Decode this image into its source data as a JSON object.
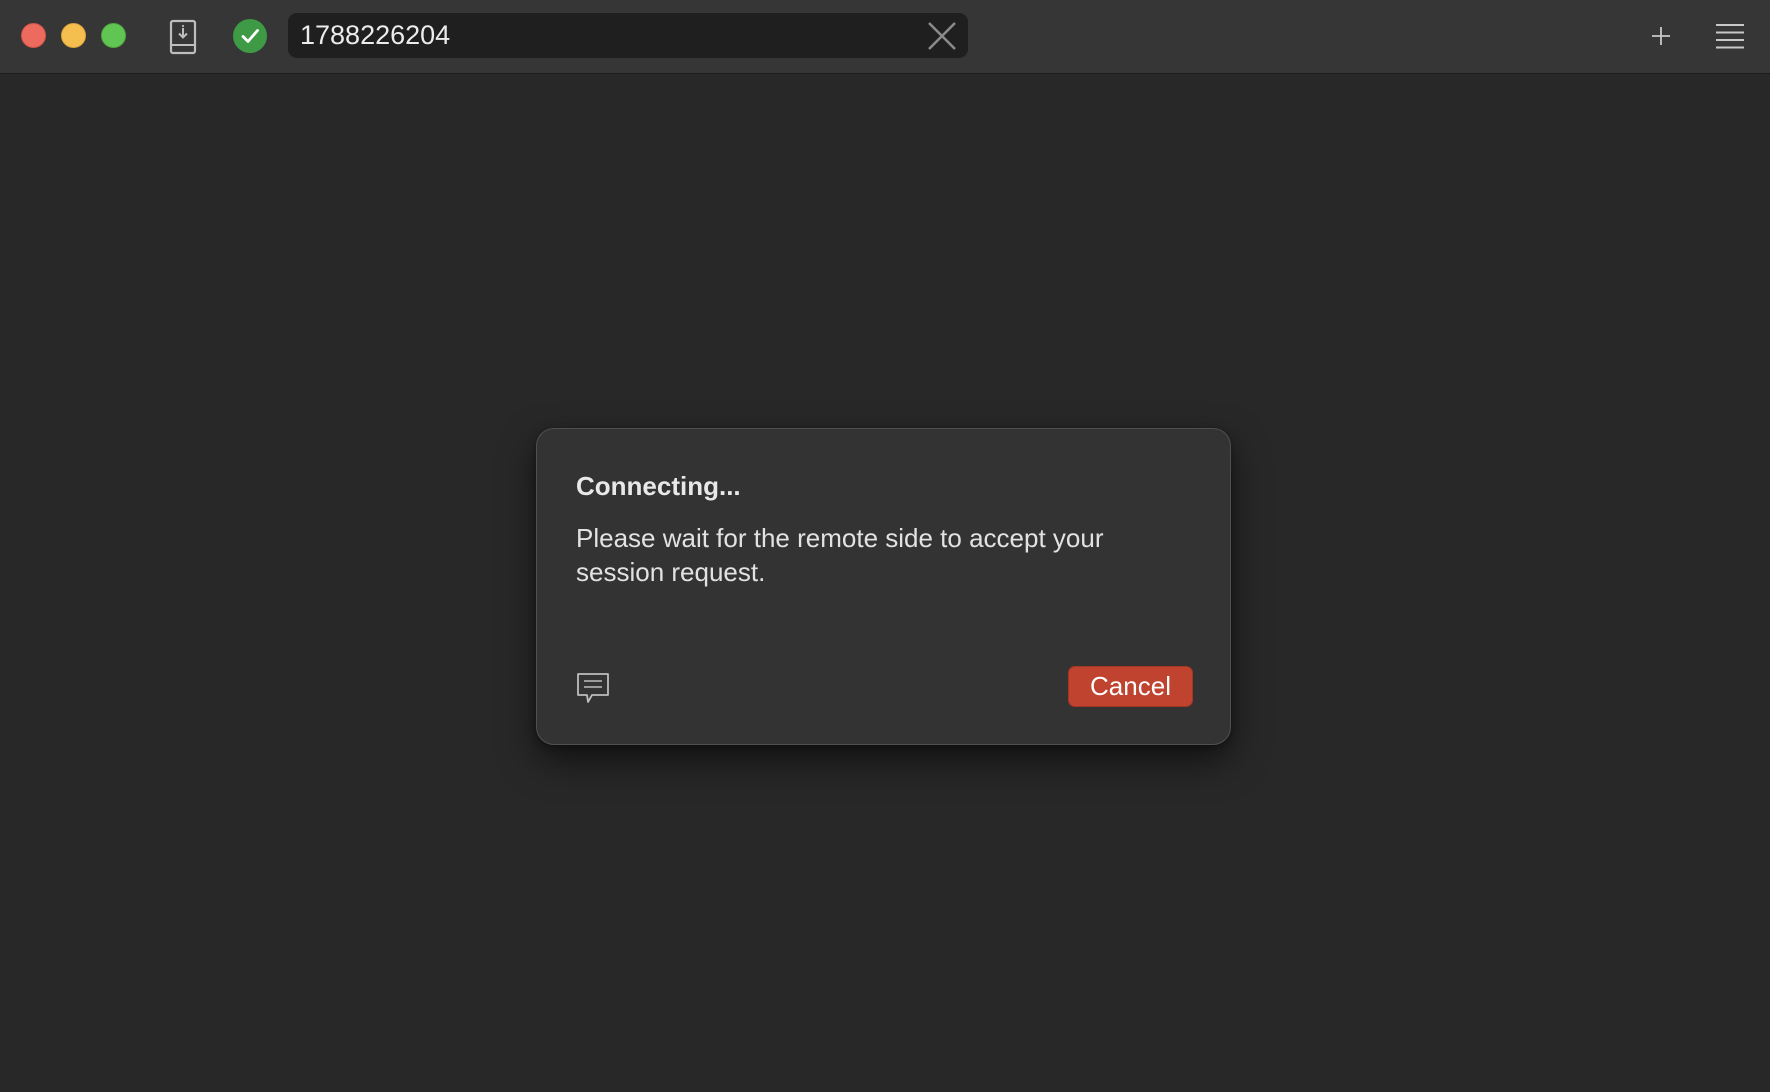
{
  "window": {
    "controls": [
      "close",
      "minimize",
      "maximize"
    ]
  },
  "toolbar": {
    "address_icon": "address-book-icon",
    "status_icon": "connected-check-icon",
    "address_value": "1788226204",
    "clear_icon": "close-icon",
    "new_tab_icon": "plus-icon",
    "menu_icon": "hamburger-menu-icon"
  },
  "dialog": {
    "title": "Connecting...",
    "message": "Please wait for the remote side to accept your session request.",
    "chat_icon": "chat-icon",
    "cancel_label": "Cancel"
  },
  "colors": {
    "background": "#282828",
    "titlebar": "#363636",
    "dialog": "#333333",
    "cancel_button": "#c0432f",
    "status_green": "#3e9a44",
    "traffic_close": "#ed6a5e",
    "traffic_minimize": "#f5bf4f",
    "traffic_maximize": "#61c554"
  }
}
